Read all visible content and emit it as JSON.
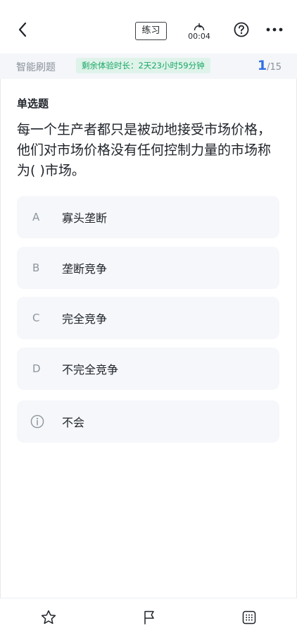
{
  "header": {
    "mode_badge": "练习",
    "timer": "00:04"
  },
  "infobar": {
    "mode_label": "智能刷题",
    "trial_text": "剩余体验时长：2天23小时59分钟",
    "progress_current": "1",
    "progress_total": "/15"
  },
  "question": {
    "type": "单选题",
    "text": "每一个生产者都只是被动地接受市场价格，他们对市场价格没有任何控制力量的市场称为( )市场。"
  },
  "options": [
    {
      "letter": "A",
      "text": "寡头垄断"
    },
    {
      "letter": "B",
      "text": "垄断竞争"
    },
    {
      "letter": "C",
      "text": "完全竞争"
    },
    {
      "letter": "D",
      "text": "不完全竞争"
    }
  ],
  "dont_know": {
    "text": "不会",
    "icon": "info-icon"
  },
  "bottom_bar": {
    "icons": [
      "star-icon",
      "flag-icon",
      "answer-sheet-icon"
    ]
  },
  "colors": {
    "accent": "#2f6fe4",
    "trial_bg": "#dff3ea",
    "trial_text": "#19a766",
    "option_bg": "#f5f7fa"
  }
}
